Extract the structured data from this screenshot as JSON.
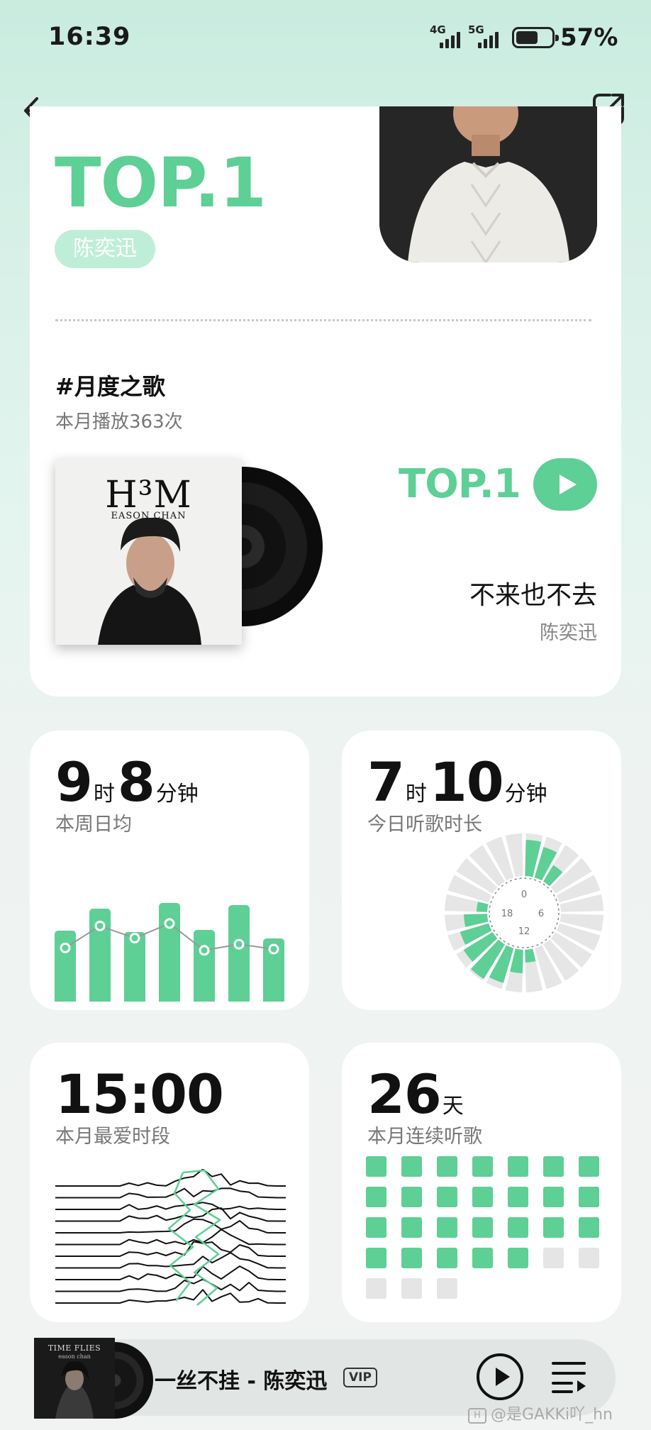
{
  "status_bar": {
    "time": "16:39",
    "signal1_label": "4G",
    "signal2_label": "5G",
    "battery": "57%"
  },
  "nav": {
    "back_icon": "arrow-left-icon",
    "share_icon": "share-icon"
  },
  "top_artist": {
    "rank": "TOP.1",
    "name": "陈奕迅"
  },
  "song_of_month": {
    "heading": "#月度之歌",
    "plays": "本月播放363次",
    "album_title": "H³M",
    "album_artist": "EASON CHAN",
    "rank": "TOP.1",
    "title": "不来也不去",
    "artist": "陈奕迅"
  },
  "weekly_avg": {
    "hours": "9",
    "hours_unit": "时",
    "minutes": "8",
    "minutes_unit": "分钟",
    "label": "本周日均",
    "chart_data": {
      "type": "bar",
      "bar_values": [
        0.58,
        0.76,
        0.57,
        0.81,
        0.59,
        0.79,
        0.52
      ],
      "line_values": [
        0.44,
        0.62,
        0.52,
        0.64,
        0.42,
        0.47,
        0.43
      ],
      "color": "#5ecf95"
    }
  },
  "today": {
    "hours": "7",
    "hours_unit": "时",
    "minutes": "10",
    "minutes_unit": "分钟",
    "label": "今日听歌时长",
    "clock_labels": [
      "0",
      "6",
      "12",
      "18"
    ],
    "chart_data": {
      "type": "radial-bar",
      "segments": 24,
      "hour_values": [
        0.85,
        0.75,
        0.45,
        0,
        0,
        0,
        0,
        0,
        0,
        0,
        0,
        0.3,
        0.55,
        0.85,
        0.95,
        0.8,
        0.7,
        0.55,
        0.25,
        0,
        0,
        0,
        0,
        0
      ],
      "color": "#5ecf95",
      "track_color": "#e6e6e6"
    }
  },
  "favorite_time": {
    "time": "15:00",
    "label": "本月最爱时段"
  },
  "streak": {
    "days": "26",
    "days_unit": "天",
    "label": "本月连续听歌",
    "active_days": 26,
    "total_days": 31
  },
  "player": {
    "cover_title": "TIME FLIES",
    "cover_artist": "eason chan",
    "track": "一丝不挂 - 陈奕迅",
    "badge": "VIP",
    "play_icon": "play-icon",
    "playlist_icon": "playlist-icon"
  },
  "watermark": "@是GAKKi吖_hn",
  "colors": {
    "accent": "#5ecf95",
    "accent_light": "#bfeed8"
  }
}
